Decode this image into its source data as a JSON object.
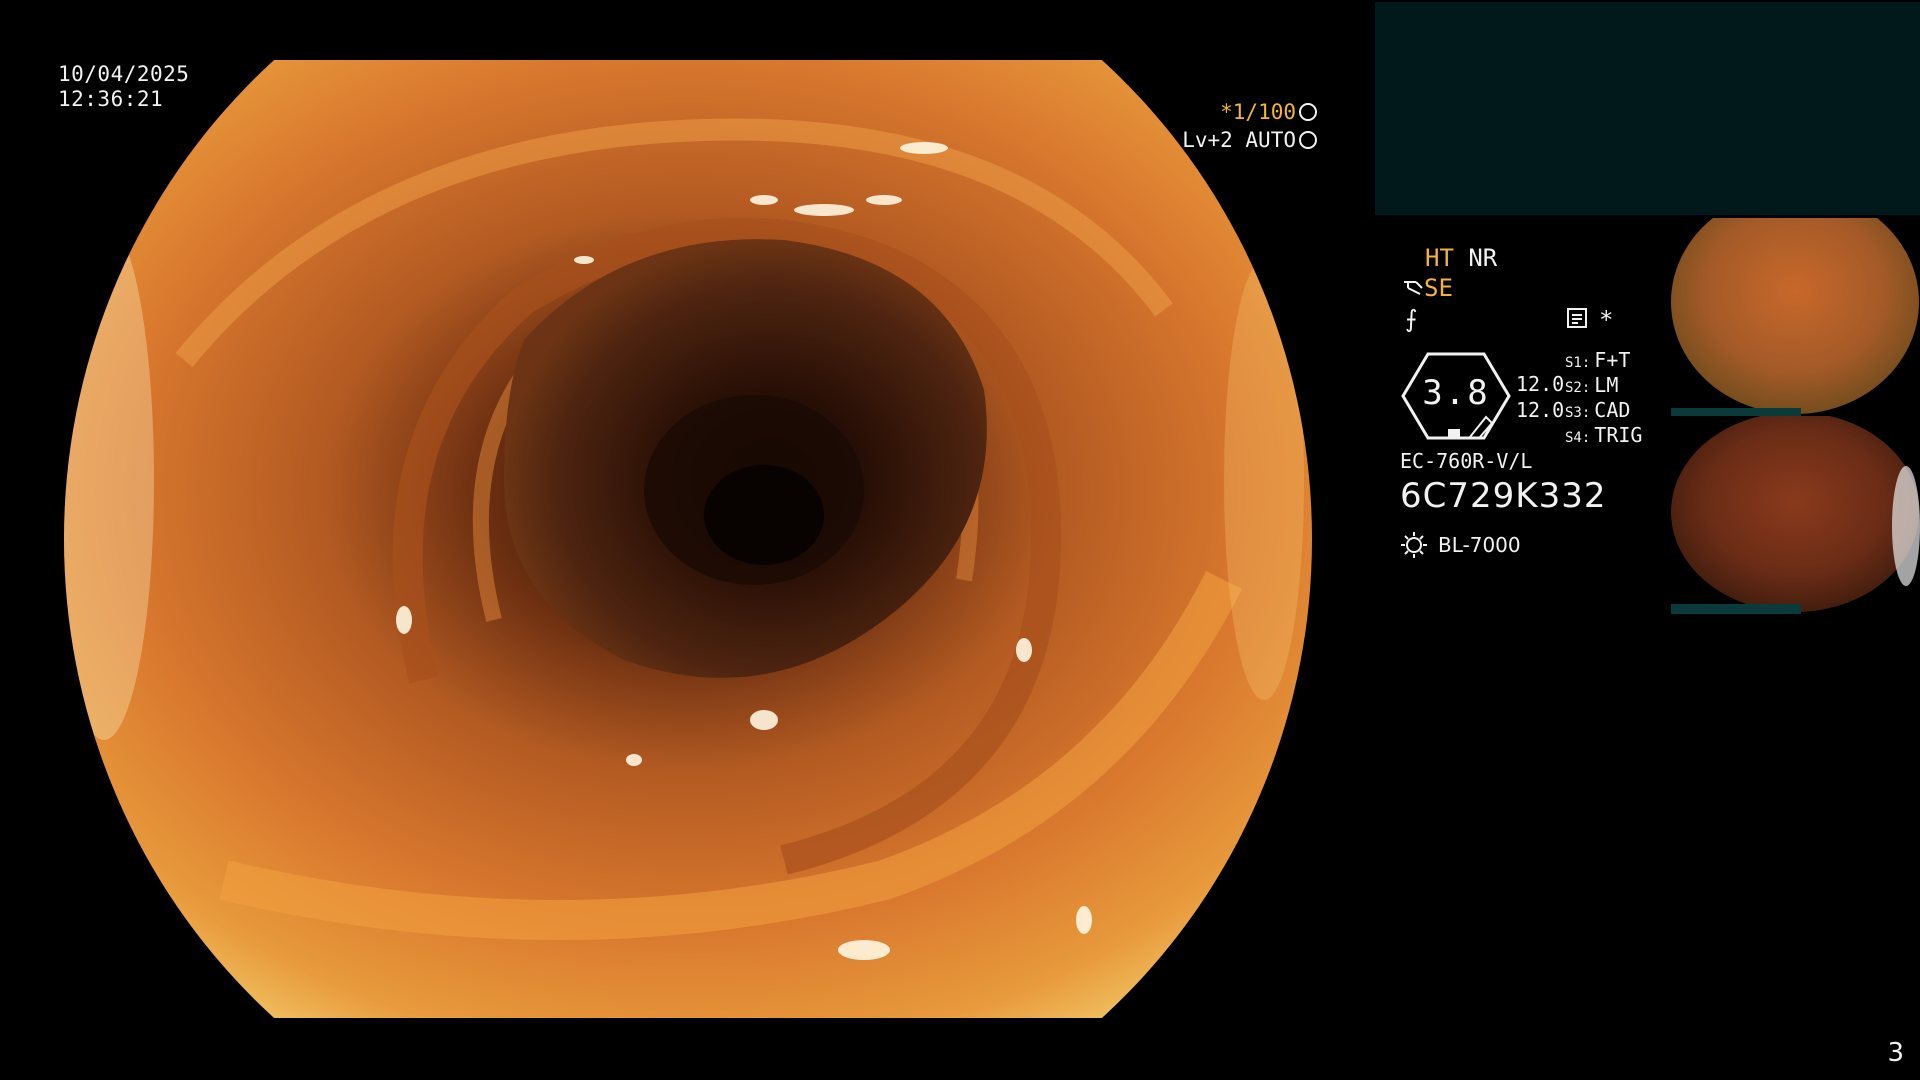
{
  "overlay": {
    "date": "10/04/2025",
    "time": "12:36:21",
    "shutter": "*1/100",
    "level": "Lv+2 AUTO"
  },
  "panel": {
    "ht": "HT",
    "nr": "NR",
    "se": "SE",
    "f_symbol": "⨍",
    "star": "*",
    "hex_value": "3.8",
    "value_1": "12.0",
    "value_2": "12.0",
    "switches": [
      {
        "key": "S1:",
        "value": "F+T"
      },
      {
        "key": "S2:",
        "value": "LM"
      },
      {
        "key": "S3:",
        "value": "CAD"
      },
      {
        "key": "S4:",
        "value": "TRIG"
      }
    ],
    "scope_model": "EC-760R-V/L",
    "serial": "6C729K332",
    "light_source": "BL-7000"
  },
  "page_number": "3",
  "colors": {
    "amber": "#f2b43a",
    "teal_box": "#02191b",
    "mucosa": "#c86a2a"
  },
  "icons": [
    "shutter-icon",
    "auto-icon",
    "scope-icon",
    "doc-icon",
    "light-icon"
  ]
}
